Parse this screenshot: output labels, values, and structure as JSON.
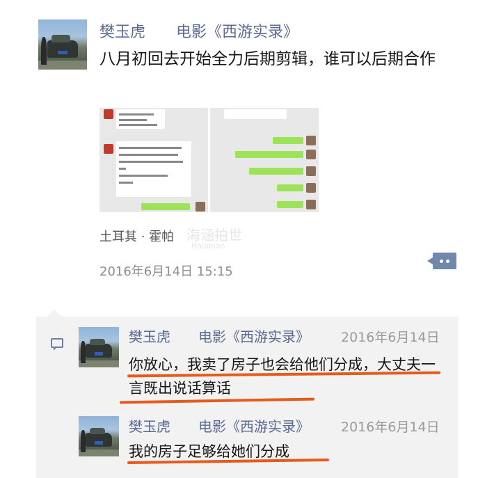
{
  "post": {
    "author": "樊玉虎　　电影《西游实录》",
    "body": "八月初回去开始全力后期剪辑，谁可以后期合作",
    "location": "土耳其 · 霍帕",
    "timestamp": "2016年6月14日 15:15"
  },
  "thumbnails": [
    {
      "icon": "chat-screenshot-image"
    },
    {
      "icon": "chat-screenshot-image"
    }
  ],
  "watermark": {
    "main": "海涵拍世",
    "sub": "Haiabian"
  },
  "comments": [
    {
      "author": "樊玉虎　　电影《西游实录》",
      "date": "2016年6月14日",
      "text": "你放心，我卖了房子也会给他们分成，大丈夫一言既出说话算话"
    },
    {
      "author": "樊玉虎　　电影《西游实录》",
      "date": "2016年6月14日",
      "text": "我的房子足够给她们分成"
    }
  ],
  "colors": {
    "name_link": "#5a6b93",
    "underline_annotation": "#e65a1c",
    "comment_panel": "#f2f2f2"
  }
}
